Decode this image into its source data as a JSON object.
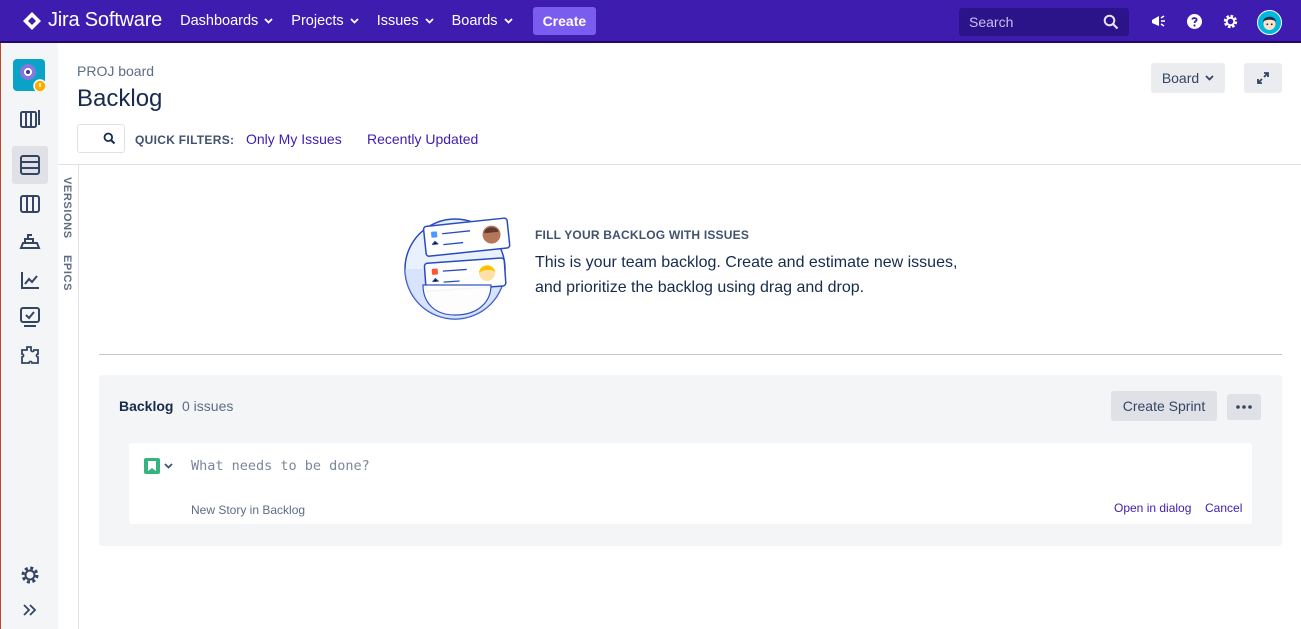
{
  "app": {
    "product_name": "Jira Software"
  },
  "topnav": {
    "items": [
      {
        "label": "Dashboards"
      },
      {
        "label": "Projects"
      },
      {
        "label": "Issues"
      },
      {
        "label": "Boards"
      }
    ],
    "create_label": "Create",
    "search_placeholder": "Search",
    "icons": [
      "notifications-icon",
      "help-icon",
      "settings-icon",
      "profile-avatar"
    ]
  },
  "sidebar": {
    "items": [
      "project-avatar",
      "roadmap-icon",
      "backlog-icon",
      "board-icon",
      "releases-icon",
      "reports-icon",
      "issues-icon",
      "components-icon"
    ],
    "active": "backlog-icon",
    "bottom": [
      "project-settings-icon",
      "expand-sidebar-icon"
    ]
  },
  "vertical_tabs": [
    "VERSIONS",
    "EPICS"
  ],
  "header": {
    "breadcrumb": "PROJ board",
    "title": "Backlog",
    "board_button": "Board"
  },
  "quick_filters": {
    "label": "QUICK FILTERS:",
    "filters": [
      "Only My Issues",
      "Recently Updated"
    ]
  },
  "empty_state": {
    "heading": "FILL YOUR BACKLOG WITH ISSUES",
    "line1": "This is your team backlog. Create and estimate new issues,",
    "line2": "and prioritize the backlog using drag and drop."
  },
  "backlog": {
    "title": "Backlog",
    "count": "0 issues",
    "create_sprint": "Create Sprint",
    "inline_create": {
      "placeholder": "What needs to be done?",
      "hint": "New Story in Backlog",
      "open_in_dialog": "Open in dialog",
      "cancel": "Cancel"
    }
  },
  "colors": {
    "topnav": "#3e1cb0",
    "create_button": "#7a5cf0",
    "link": "#3e1cb0",
    "story": "#36b37e"
  }
}
